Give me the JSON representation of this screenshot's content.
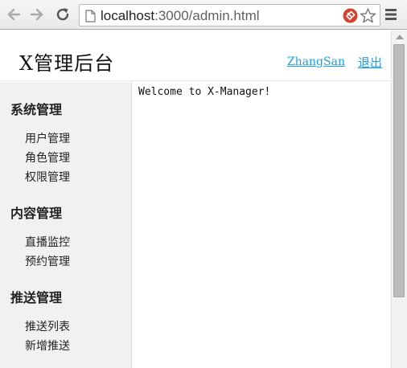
{
  "browser": {
    "url_host": "localhost",
    "url_rest": ":3000/admin.html",
    "icons": {
      "back": "back-arrow-icon",
      "forward": "forward-arrow-icon",
      "reload": "reload-icon",
      "page": "page-icon",
      "extension": "extension-icon",
      "bookmark": "star-icon",
      "menu": "hamburger-menu-icon"
    }
  },
  "header": {
    "title": "X管理后台",
    "user_link": "ZhangSan",
    "logout_link": "退出",
    "link_color": "#1aa0e6"
  },
  "sidebar": {
    "groups": [
      {
        "title": "系统管理",
        "items": [
          "用户管理",
          "角色管理",
          "权限管理"
        ]
      },
      {
        "title": "内容管理",
        "items": [
          "直播监控",
          "预约管理"
        ]
      },
      {
        "title": "推送管理",
        "items": [
          "推送列表",
          "新增推送"
        ]
      }
    ]
  },
  "main": {
    "welcome": "Welcome to X-Manager!"
  }
}
